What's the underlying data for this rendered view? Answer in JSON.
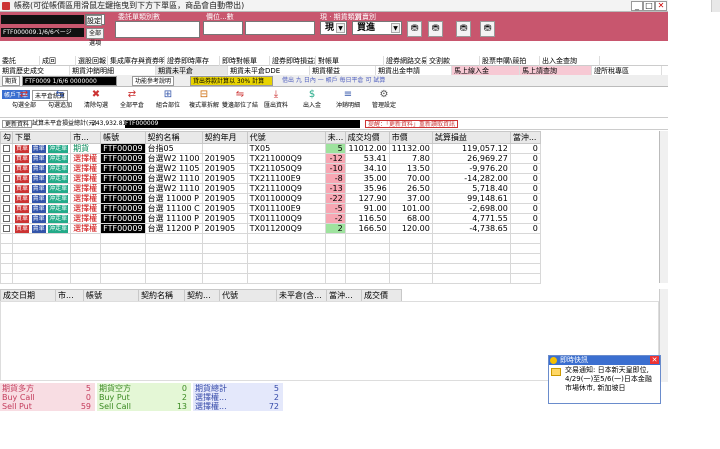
{
  "window": {
    "title": "帳務(可從帳價區用滑鼠左鍵拖曳到下方下單區，商品會自動帶出)",
    "min": "_",
    "max": "□",
    "close": "✕"
  },
  "order": {
    "labels": {
      "submit": "送出",
      "qty_units": "委託單類別數",
      "price_units": "價位...數",
      "trade_type": "現 · 期貨類別",
      "dr": "買賣別"
    },
    "tag1": "設定",
    "tag2": "全部選項",
    "acct_dark": "FTF000009.1/6/6ページ",
    "market": "現",
    "side": "買進"
  },
  "menu1": [
    {
      "label": "委託",
      "style": ""
    },
    {
      "label": "成回",
      "style": ""
    },
    {
      "label": "選股回報",
      "style": ""
    },
    {
      "label": "集成庫存與資券明細",
      "style": ""
    },
    {
      "label": "證券即時庫存",
      "style": ""
    },
    {
      "label": "即時對帳單",
      "style": ""
    },
    {
      "label": "證券即時損益試算",
      "style": ""
    },
    {
      "label": "對帳單",
      "style": ""
    },
    {
      "label": "證券網路交易額度",
      "style": ""
    },
    {
      "label": "交割款",
      "style": ""
    },
    {
      "label": "股票申購\\競拍",
      "style": ""
    },
    {
      "label": "出入金查詢",
      "style": ""
    }
  ],
  "menu2": [
    {
      "label": "期貨歷史成交",
      "style": ""
    },
    {
      "label": "期貨沖銷明細",
      "style": ""
    },
    {
      "label": "期貨未平倉",
      "style": "gr"
    },
    {
      "label": "期貨未平倉DDE",
      "style": ""
    },
    {
      "label": "期貨權益",
      "style": ""
    },
    {
      "label": "期貨出金申請",
      "style": ""
    },
    {
      "label": "馬上線入金",
      "style": "pk"
    },
    {
      "label": "馬上請查詢",
      "style": "pk"
    },
    {
      "label": "證所稅專區",
      "style": ""
    }
  ],
  "subtabs": {
    "left": "期貨",
    "acct": "FTF0009 1/6/6 0000000",
    "func": "功能參考說明",
    "mid": "貸出券款計算以 30% 計算",
    "note": "借出 九 日內 一 帳戶 每日平倉 可 試算 持有 未平倉 之 預估 損益 試 算 資料"
  },
  "toolbar": {
    "section": "帳戶下單",
    "sub": "未平倉統算",
    "buttons": [
      {
        "label": "勾選全部",
        "icon": "⇄"
      },
      {
        "label": "勾選追加",
        "icon": "⇆"
      },
      {
        "label": "清除勾選",
        "icon": "✖"
      },
      {
        "label": "全部平倉",
        "icon": "⇄"
      },
      {
        "label": "組合部位",
        "icon": "⊞"
      },
      {
        "label": "複式單拆解",
        "icon": "⊟"
      },
      {
        "label": "雙邊部位了結",
        "icon": "⇋"
      },
      {
        "label": "匯出資料",
        "icon": "⤓"
      },
      {
        "label": "出入金",
        "icon": "$"
      },
      {
        "label": "沖銷明細",
        "icon": "≡"
      },
      {
        "label": "管理設定",
        "icon": "⚙"
      }
    ]
  },
  "acctbar": {
    "refresh": "更新資料",
    "note": "試算未平倉損益總計(元)",
    "total": "243,932.81",
    "acct": "FTF000009",
    "warn": "提醒：「更新資料」重新讀取資訊"
  },
  "grid": {
    "headers": [
      "勾",
      "下單",
      "市...",
      "帳號",
      "契約名稱",
      "契約年月",
      "代號",
      "未...",
      "成交均價",
      "市價",
      "試算損益",
      "當沖..."
    ],
    "rows": [
      {
        "mkt": "期貨",
        "name": "台指05",
        "ym": "",
        "code": "TX05",
        "qty": "5",
        "avg": "11012.00",
        "price": "11132.00",
        "pl": "119,057.12",
        "dt": "0"
      },
      {
        "mkt": "選擇權",
        "name": "台選W2 1100",
        "ym": "201905",
        "code": "TX211000Q9",
        "qty": "-12",
        "avg": "53.41",
        "price": "7.80",
        "pl": "26,969.27",
        "dt": "0"
      },
      {
        "mkt": "選擇權",
        "name": "台選W2 1105",
        "ym": "201905",
        "code": "TX211050Q9",
        "qty": "-10",
        "avg": "34.10",
        "price": "13.50",
        "pl": "-9,976.20",
        "dt": "0"
      },
      {
        "mkt": "選擇權",
        "name": "台選W2 1110",
        "ym": "201905",
        "code": "TX211100E9",
        "qty": "-8",
        "avg": "35.00",
        "price": "70.00",
        "pl": "-14,282.00",
        "dt": "0"
      },
      {
        "mkt": "選擇權",
        "name": "台選W2 1110",
        "ym": "201905",
        "code": "TX211100Q9",
        "qty": "-13",
        "avg": "35.96",
        "price": "26.50",
        "pl": "5,718.40",
        "dt": "0"
      },
      {
        "mkt": "選擇權",
        "name": "台選 11000 P",
        "ym": "201905",
        "code": "TX011000Q9",
        "qty": "-22",
        "avg": "127.90",
        "price": "37.00",
        "pl": "99,148.61",
        "dt": "0"
      },
      {
        "mkt": "選擇權",
        "name": "台選 11100 C",
        "ym": "201905",
        "code": "TX011100E9",
        "qty": "-5",
        "avg": "91.00",
        "price": "101.00",
        "pl": "-2,698.00",
        "dt": "0"
      },
      {
        "mkt": "選擇權",
        "name": "台選 11100 P",
        "ym": "201905",
        "code": "TX011100Q9",
        "qty": "-2",
        "avg": "116.50",
        "price": "68.00",
        "pl": "4,771.55",
        "dt": "0"
      },
      {
        "mkt": "選擇權",
        "name": "台選 11200 P",
        "ym": "201905",
        "code": "TX011200Q9",
        "qty": "2",
        "avg": "166.50",
        "price": "120.00",
        "pl": "-4,738.65",
        "dt": "0"
      }
    ],
    "tags": {
      "a": "買單",
      "b": "賣單",
      "c": "沖走單"
    },
    "acct_mask": "FTF00009"
  },
  "grid2": {
    "headers": [
      "成交日期",
      "市...",
      "帳號",
      "契約名稱",
      "契約...",
      "代號",
      "未平倉(含...",
      "當沖...",
      "成交價"
    ]
  },
  "summary": [
    {
      "rows": [
        {
          "k": "期貨多方",
          "v": "5"
        },
        {
          "k": "Buy Call",
          "v": "0"
        },
        {
          "k": "Sell Put",
          "v": "59"
        }
      ],
      "bg": "#f8dde3",
      "color": "#c43c5c"
    },
    {
      "rows": [
        {
          "k": "期貨空方",
          "v": "0"
        },
        {
          "k": "Buy Put",
          "v": "2"
        },
        {
          "k": "Sell Call",
          "v": "13"
        }
      ],
      "bg": "#e4f7d6",
      "color": "#3b8a22"
    },
    {
      "rows": [
        {
          "k": "期貨總計",
          "v": "5"
        },
        {
          "k": "選擇權...",
          "v": "2"
        },
        {
          "k": "選擇權...",
          "v": "72"
        }
      ],
      "bg": "#e4e8fb",
      "color": "#3348a8"
    }
  ],
  "popup": {
    "title": "即時快訊",
    "text": "交易通知: 日本新天皇即位, 4/29(一)至5/6(一)日本金融市場休市, 新加坡日"
  }
}
